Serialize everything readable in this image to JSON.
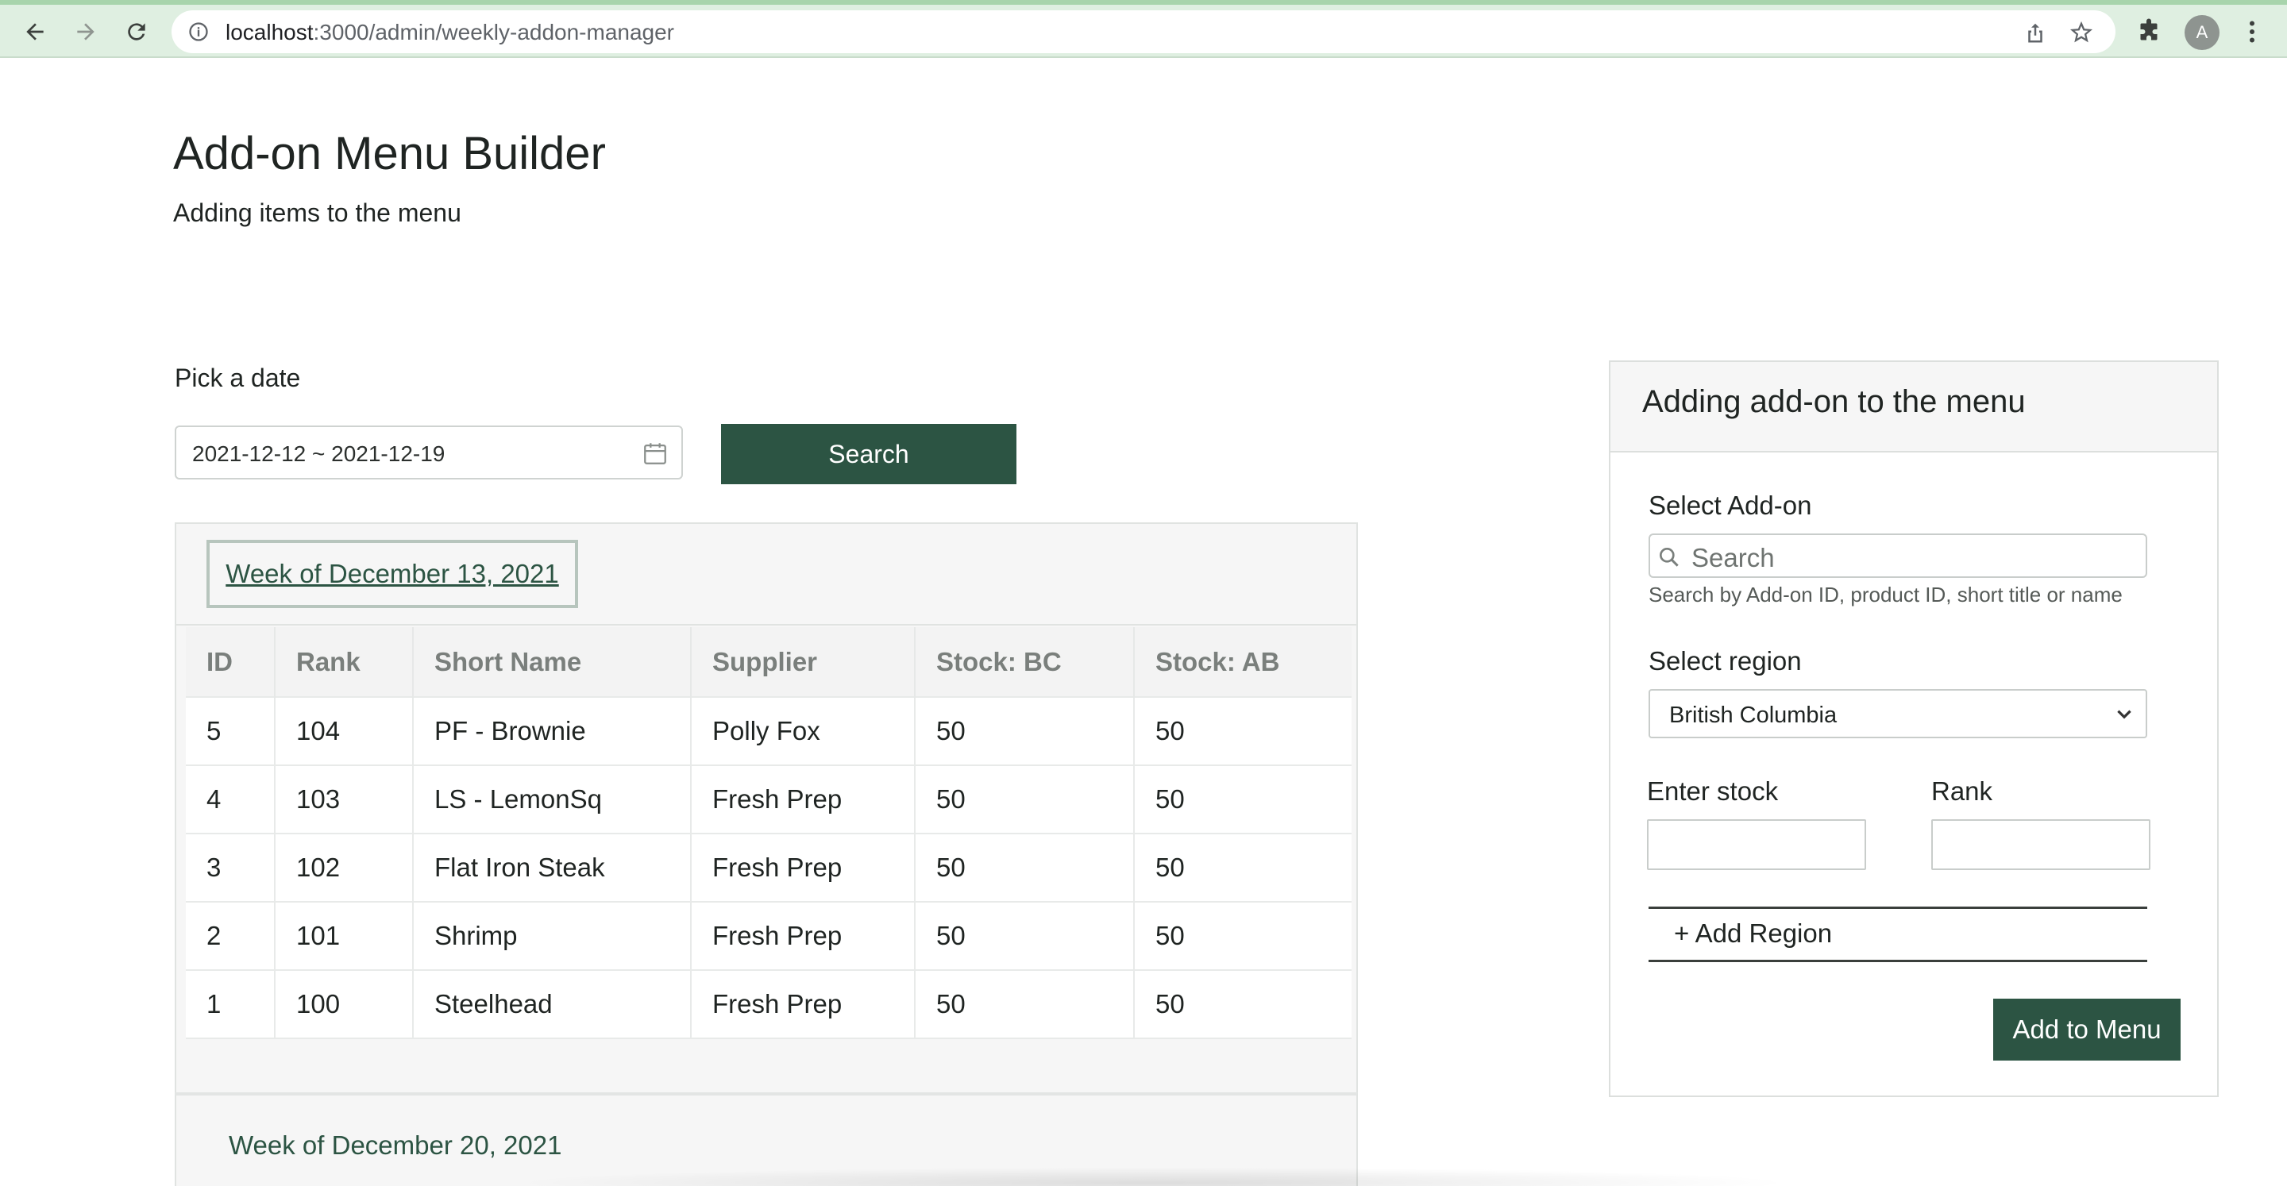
{
  "browser": {
    "url_host": "localhost",
    "url_path": ":3000/admin/weekly-addon-manager",
    "avatar_letter": "A"
  },
  "header": {
    "title": "Add-on Menu Builder",
    "subtitle": "Adding items to the menu"
  },
  "date_picker": {
    "label": "Pick a date",
    "value": "2021-12-12 ~ 2021-12-19",
    "search_label": "Search"
  },
  "weeks": [
    {
      "heading": "Week of December 13, 2021",
      "columns": [
        "ID",
        "Rank",
        "Short Name",
        "Supplier",
        "Stock: BC",
        "Stock: AB"
      ],
      "rows": [
        [
          "5",
          "104",
          "PF - Brownie",
          "Polly Fox",
          "50",
          "50"
        ],
        [
          "4",
          "103",
          "LS - LemonSq",
          "Fresh Prep",
          "50",
          "50"
        ],
        [
          "3",
          "102",
          "Flat Iron Steak",
          "Fresh Prep",
          "50",
          "50"
        ],
        [
          "2",
          "101",
          "Shrimp",
          "Fresh Prep",
          "50",
          "50"
        ],
        [
          "1",
          "100",
          "Steelhead",
          "Fresh Prep",
          "50",
          "50"
        ]
      ]
    },
    {
      "heading": "Week of December 20, 2021"
    }
  ],
  "add_card": {
    "title": "Adding add-on to the menu",
    "select_addon_label": "Select Add-on",
    "search_placeholder": "Search",
    "search_hint": "Search by Add-on ID, product ID, short title or name",
    "region_label": "Select region",
    "region_value": "British Columbia",
    "stock_label": "Enter stock",
    "stock_value": "",
    "rank_label": "Rank",
    "rank_value": "",
    "add_region_label": "+ Add Region",
    "submit_label": "Add to Menu"
  },
  "colors": {
    "brand_green": "#2c5443",
    "chrome_bg": "#dfefe1"
  }
}
